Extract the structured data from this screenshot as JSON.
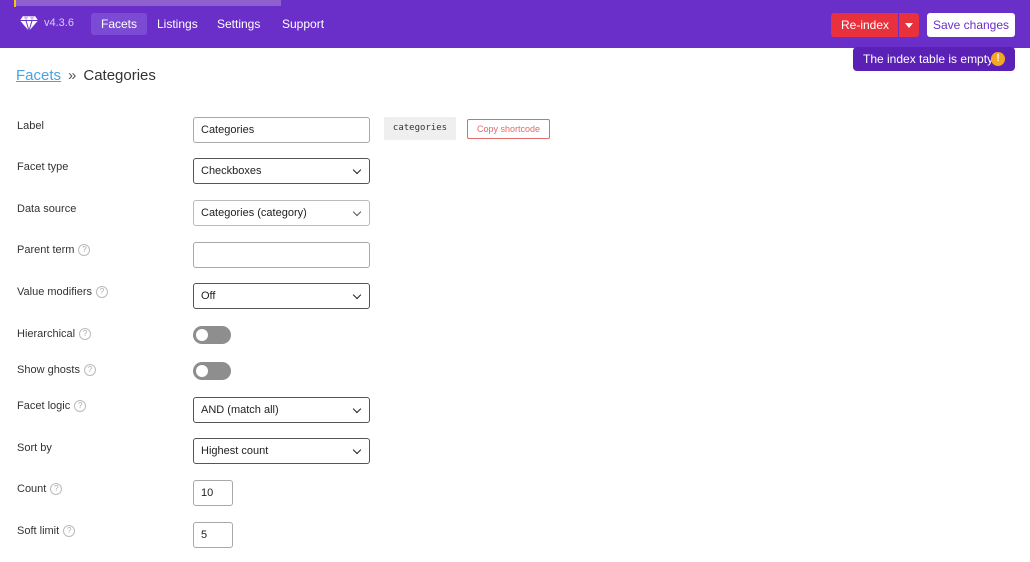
{
  "header": {
    "version": "v4.3.6",
    "nav": [
      {
        "label": "Facets",
        "active": true
      },
      {
        "label": "Listings",
        "active": false
      },
      {
        "label": "Settings",
        "active": false
      },
      {
        "label": "Support",
        "active": false
      }
    ],
    "reindex_label": "Re-index",
    "save_label": "Save changes",
    "tooltip_text": "The index table is empty",
    "tooltip_badge": "!",
    "brand_color": "#6a2fc9",
    "danger_color": "#e8313c"
  },
  "breadcrumb": {
    "parent": "Facets",
    "separator": "»",
    "current": "Categories"
  },
  "form": {
    "label": {
      "label": "Label",
      "value": "Categories",
      "shortcode": "categories",
      "copy_label": "Copy shortcode"
    },
    "facet_type": {
      "label": "Facet type",
      "value": "Checkboxes"
    },
    "data_source": {
      "label": "Data source",
      "value": "Categories (category)"
    },
    "parent_term": {
      "label": "Parent term",
      "value": "",
      "help_icon": "question-circle-icon"
    },
    "value_modifiers": {
      "label": "Value modifiers",
      "value": "Off"
    },
    "hierarchical": {
      "label": "Hierarchical",
      "enabled": false
    },
    "show_ghosts": {
      "label": "Show ghosts",
      "enabled": false
    },
    "facet_logic": {
      "label": "Facet logic",
      "value": "AND (match all)"
    },
    "sort_by": {
      "label": "Sort by",
      "value": "Highest count"
    },
    "count": {
      "label": "Count",
      "value": "10"
    },
    "soft_limit": {
      "label": "Soft limit",
      "value": "5"
    },
    "help_glyph": "?"
  }
}
